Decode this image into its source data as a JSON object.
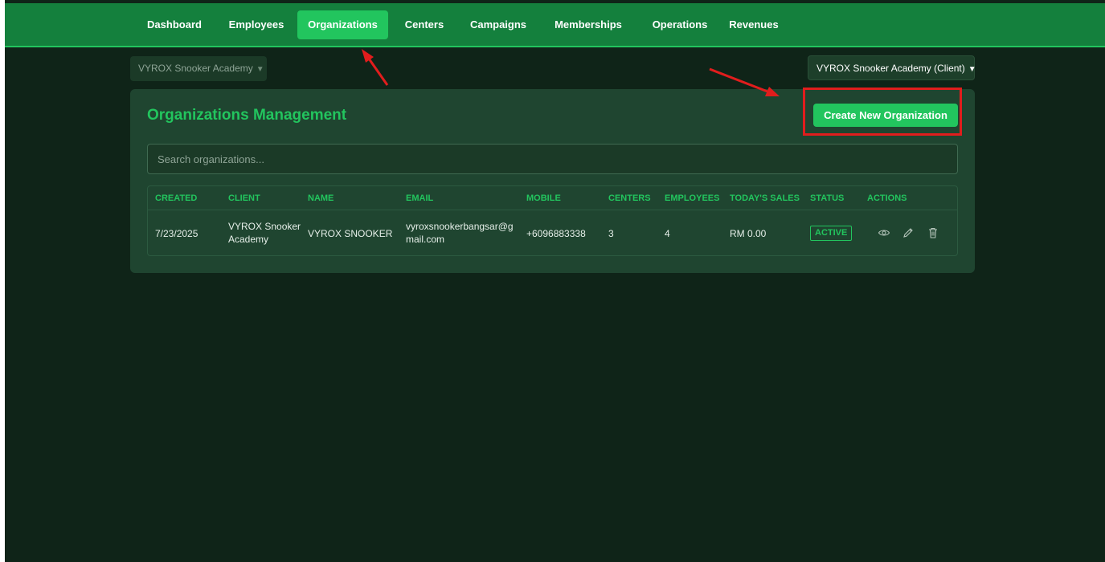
{
  "nav": {
    "items": [
      {
        "label": "Dashboard"
      },
      {
        "label": "Employees"
      },
      {
        "label": "Organizations",
        "active": true
      },
      {
        "label": "Centers"
      },
      {
        "label": "Campaigns"
      },
      {
        "label": "Memberships"
      },
      {
        "label": "Operations"
      },
      {
        "label": "Revenues"
      }
    ]
  },
  "org_selector": {
    "value": "VYROX Snooker Academy"
  },
  "client_selector": {
    "value": "VYROX Snooker Academy (Client)"
  },
  "page": {
    "title": "Organizations Management",
    "create_button": "Create New Organization",
    "search_placeholder": "Search organizations..."
  },
  "table": {
    "headers": {
      "created": "CREATED",
      "client": "CLIENT",
      "name": "NAME",
      "email": "EMAIL",
      "mobile": "MOBILE",
      "centers": "CENTERS",
      "employees": "EMPLOYEES",
      "todays_sales": "TODAY'S SALES",
      "status": "STATUS",
      "actions": "ACTIONS"
    },
    "rows": [
      {
        "created": "7/23/2025",
        "client_line1": "VYROX Snooker",
        "client_line2": "Academy",
        "name": "VYROX SNOOKER",
        "email_line1": "vyroxsnookerbangsar@g",
        "email_line2": "mail.com",
        "mobile": "+6096883338",
        "centers": "3",
        "employees": "4",
        "todays_sales": "RM 0.00",
        "status": "ACTIVE"
      }
    ]
  },
  "icons": {
    "view": "eye-icon",
    "edit": "pencil-icon",
    "delete": "trash-icon",
    "select_caret": "caret-down-icon"
  },
  "colors": {
    "accent": "#22c55e",
    "navbar": "#14803d",
    "background": "#0f2418",
    "card": "#1f4530",
    "annotation": "#e11d1d"
  }
}
